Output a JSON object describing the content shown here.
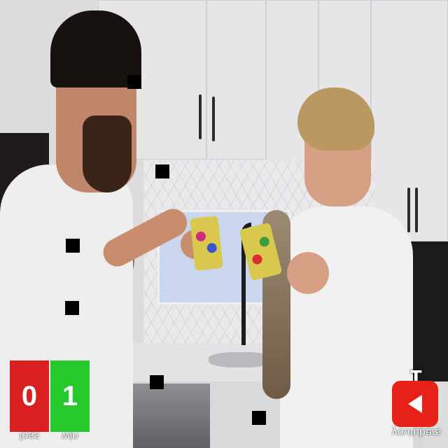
{
  "scene": {
    "description_tag": "kitchen-scene",
    "colors": {
      "cabinet": "#e6e6e8",
      "loss_box": "#d82020",
      "win_box": "#27c82b",
      "youtube_red": "#e62117"
    }
  },
  "scoreboard": {
    "loss_value": "0",
    "loss_label": "loss",
    "win_value": "1",
    "win_label": "win"
  },
  "youtubers_badge": {
    "count": "1",
    "label": "youtubers",
    "icon": "play-icon"
  }
}
